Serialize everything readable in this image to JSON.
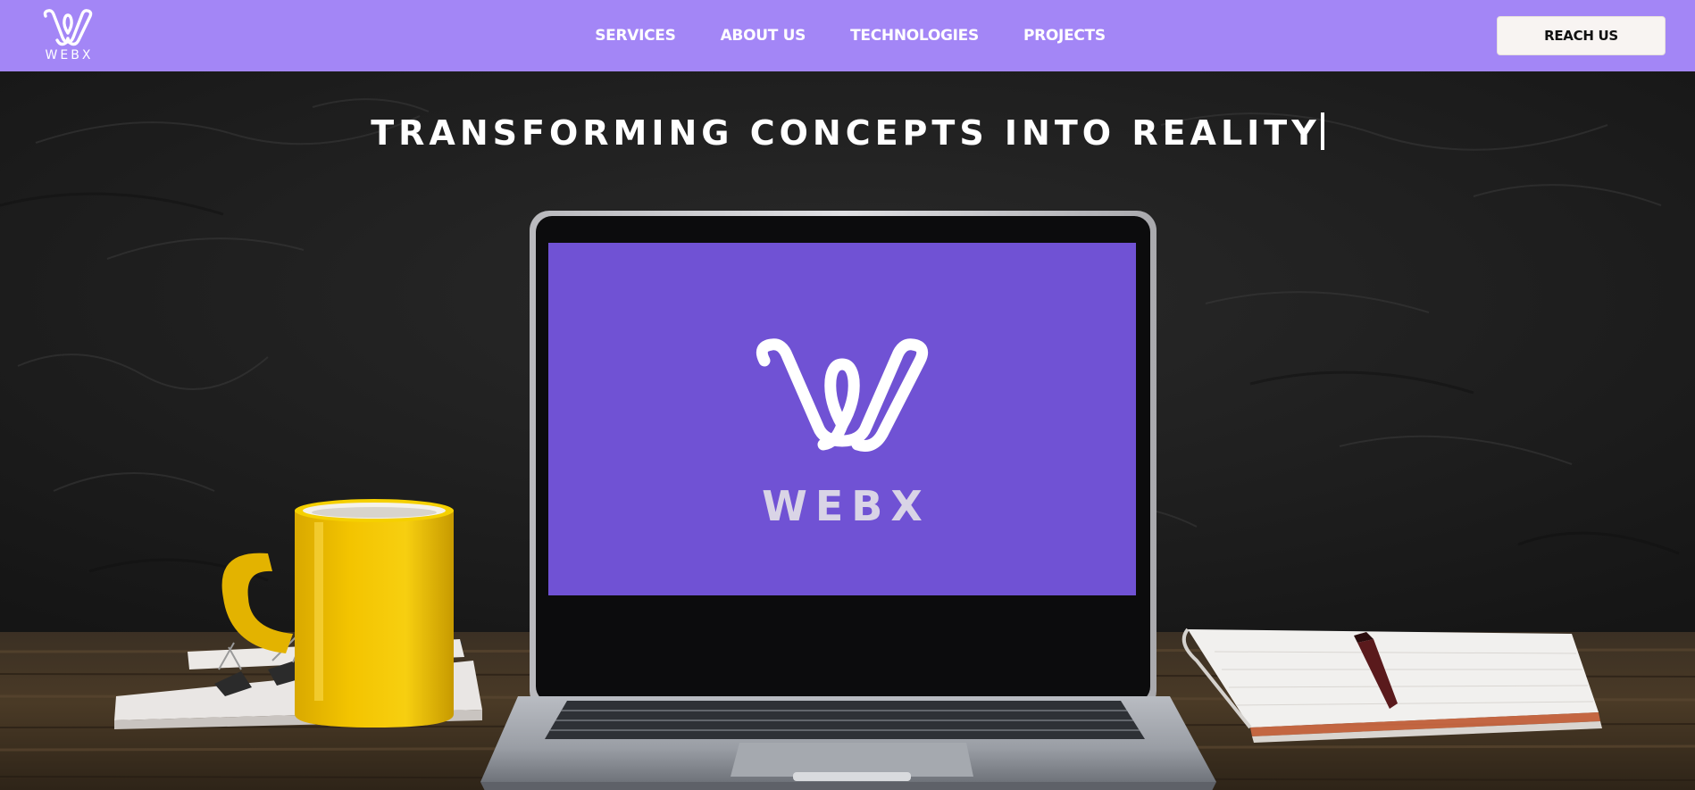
{
  "brand": {
    "name": "WEBX",
    "logo_icon": "webx-w-logo",
    "colors": {
      "nav_bg": "#a386f6",
      "screen_bg": "#7052d4"
    }
  },
  "nav": {
    "links": [
      "SERVICES",
      "ABOUT US",
      "TECHNOLOGIES",
      "PROJECTS"
    ],
    "cta_label": "REACH US"
  },
  "hero": {
    "headline": "TRANSFORMING CONCEPTS INTO REALITY",
    "screen_brand": "WEBX"
  }
}
